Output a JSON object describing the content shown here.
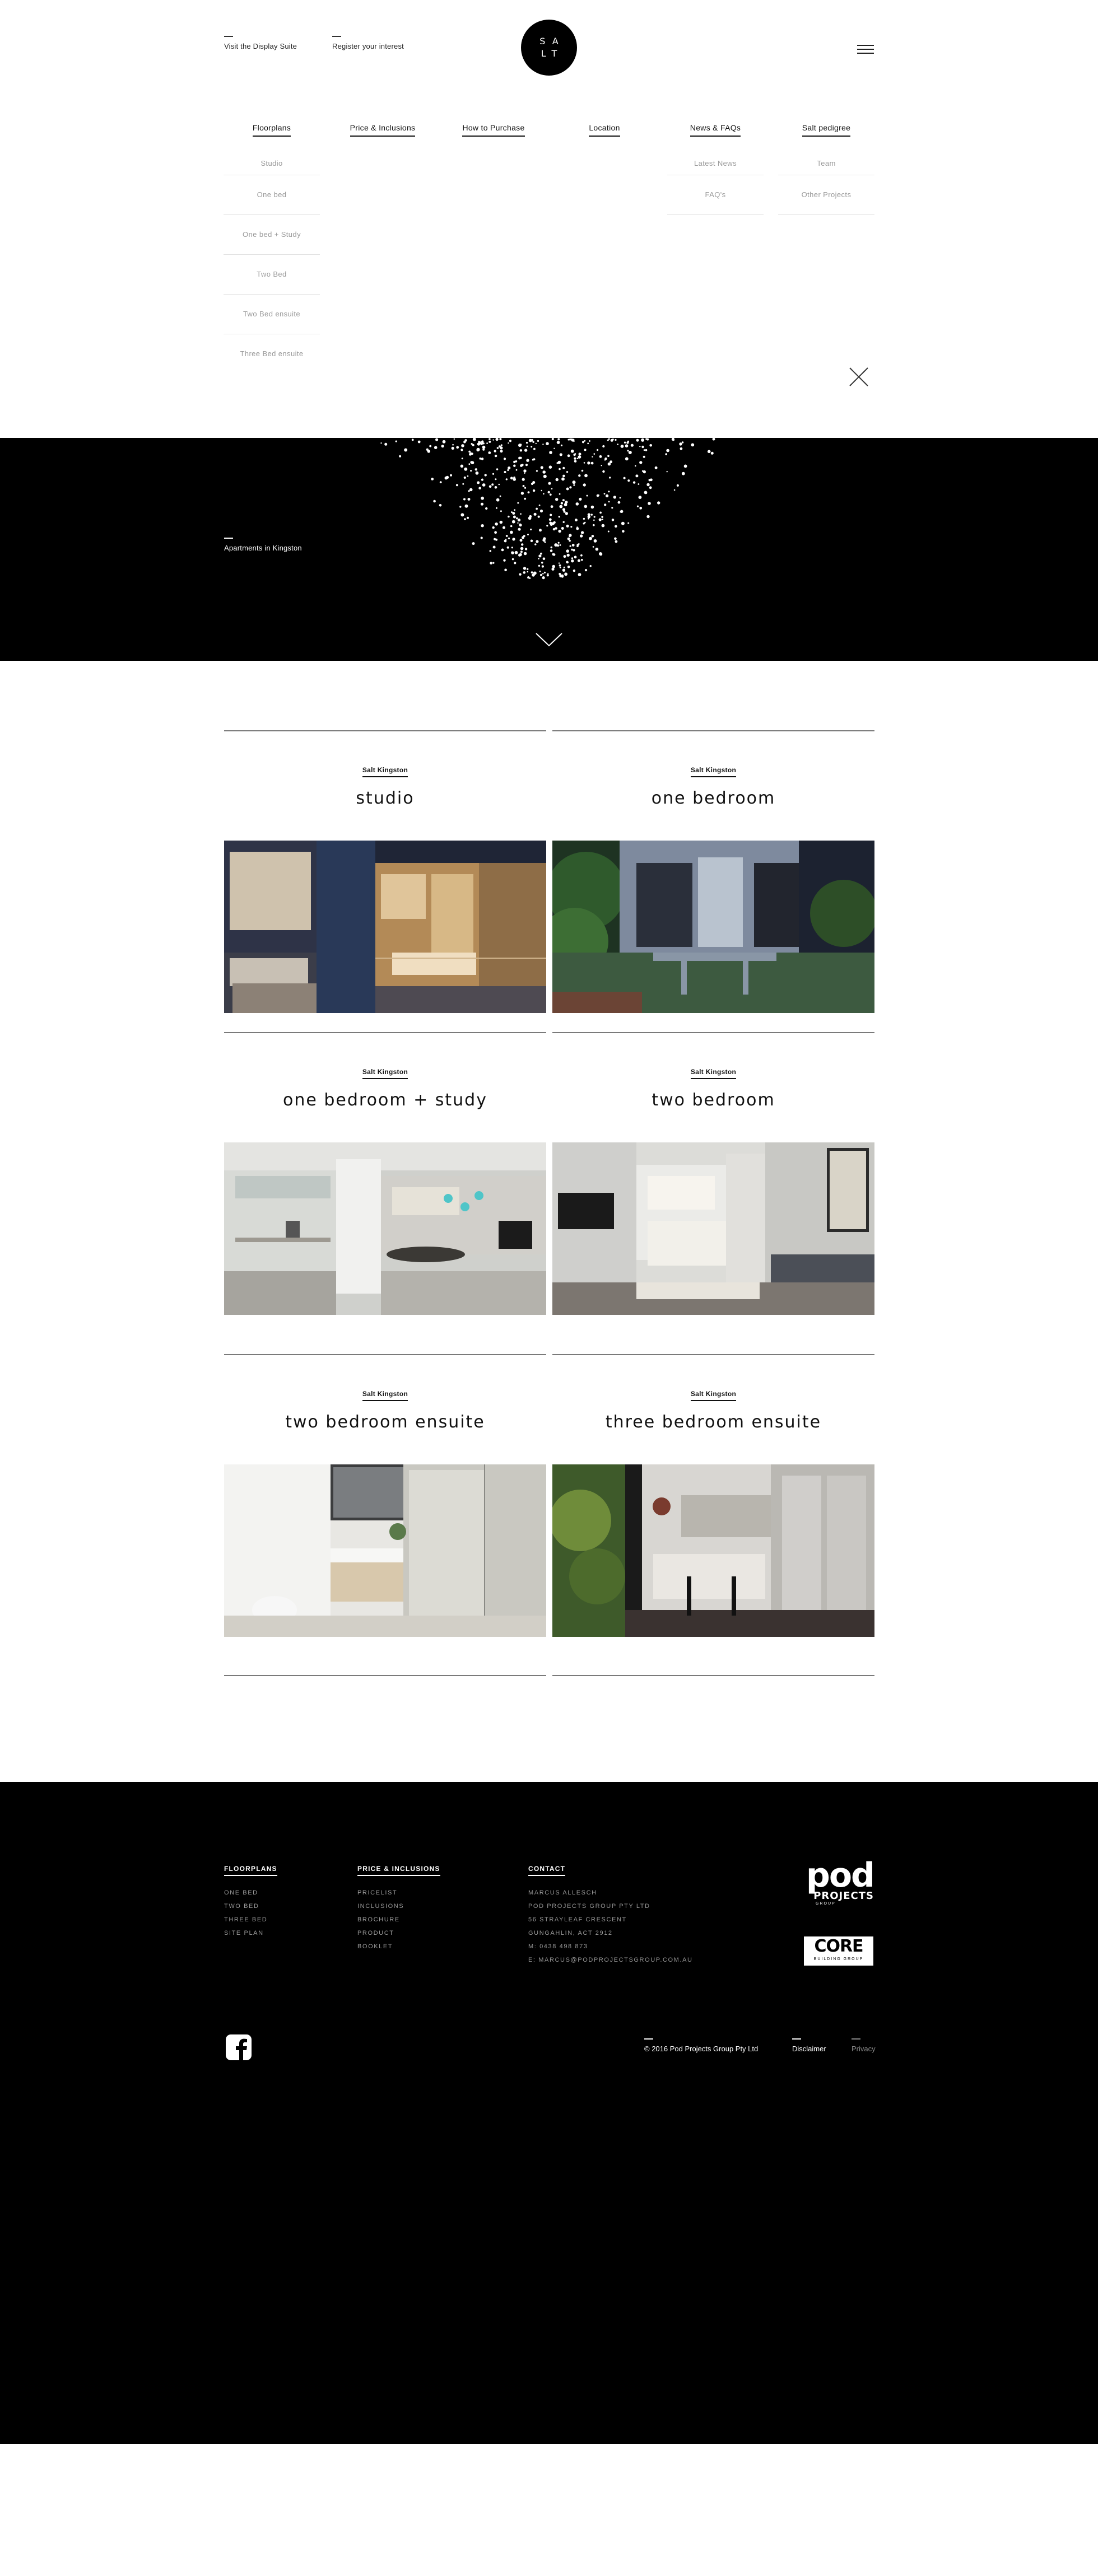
{
  "header": {
    "left_links": [
      "Visit the Display Suite",
      "Register your interest"
    ],
    "logo_lines": [
      "SA",
      "LT"
    ]
  },
  "menu": {
    "columns": [
      {
        "heading": "Floorplans",
        "items": [
          "Studio",
          "One bed",
          "One bed + Study",
          "Two Bed",
          "Two Bed ensuite",
          "Three Bed ensuite"
        ]
      },
      {
        "heading": "Price & Inclusions",
        "items": []
      },
      {
        "heading": "How to Purchase",
        "items": []
      },
      {
        "heading": "Location",
        "items": []
      },
      {
        "heading": "News & FAQs",
        "items": [
          "Latest News",
          "FAQ's"
        ]
      },
      {
        "heading": "Salt pedigree",
        "items": [
          "Team",
          "Other Projects"
        ]
      }
    ]
  },
  "hero": {
    "label": "Apartments in Kingston"
  },
  "floorplans": [
    {
      "kicker": "Salt Kingston",
      "title": "studio"
    },
    {
      "kicker": "Salt Kingston",
      "title": "one bedroom"
    },
    {
      "kicker": "Salt Kingston",
      "title": "one bedroom + study"
    },
    {
      "kicker": "Salt Kingston",
      "title": "two bedroom"
    },
    {
      "kicker": "Salt Kingston",
      "title": "two bedroom ensuite"
    },
    {
      "kicker": "Salt Kingston",
      "title": "three bedroom ensuite"
    }
  ],
  "footer": {
    "floorplans": {
      "heading": "FLOORPLANS",
      "items": [
        "ONE BED",
        "TWO BED",
        "THREE BED",
        "SITE PLAN"
      ]
    },
    "price": {
      "heading": "PRICE & INCLUSIONS",
      "items": [
        "PRICELIST",
        "INCLUSIONS",
        "BROCHURE",
        "PRODUCT",
        "BOOKLET"
      ]
    },
    "contact": {
      "heading": "CONTACT",
      "items": [
        "MARCUS ALLESCH",
        "POD PROJECTS GROUP PTY LTD",
        "56 STRAYLEAF CRESCENT",
        "GUNGAHLIN, ACT 2912",
        "M: 0438 498 873",
        "E: MARCUS@PODPROJECTSGROUP.COM.AU"
      ]
    },
    "logos": {
      "pod_main": "pod",
      "pod_sub": "PROJECTS",
      "pod_tiny": "GROUP",
      "core_main": "CORE",
      "core_sub": "BUILDING GROUP"
    },
    "copyright": "© 2016 Pod Projects Group Pty Ltd",
    "disclaimer": "Disclaimer",
    "privacy": "Privacy"
  }
}
